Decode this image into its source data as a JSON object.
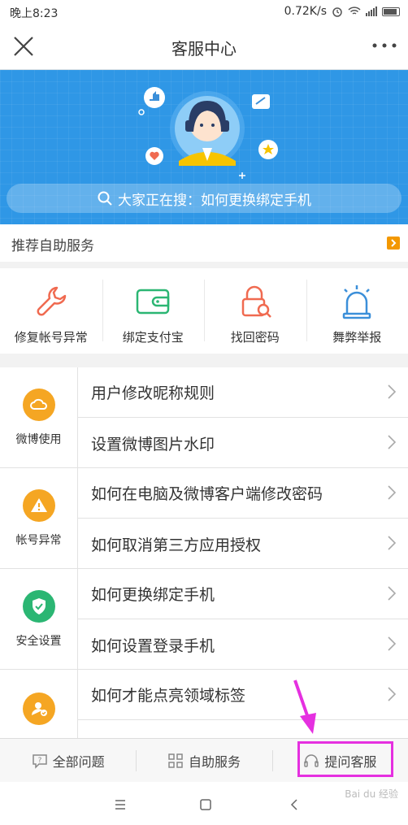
{
  "status_bar": {
    "time": "晚上8:23",
    "speed": "0.72K/s"
  },
  "header": {
    "title": "客服中心"
  },
  "banner": {
    "search_text": "大家正在搜：如何更换绑定手机"
  },
  "recommend": {
    "label": "推荐自助服务"
  },
  "quick_services": [
    {
      "label": "修复帐号异常",
      "icon": "wrench-icon",
      "color": "#f06a50"
    },
    {
      "label": "绑定支付宝",
      "icon": "wallet-icon",
      "color": "#2bb673"
    },
    {
      "label": "找回密码",
      "icon": "lock-search-icon",
      "color": "#f06a50"
    },
    {
      "label": "舞弊举报",
      "icon": "alarm-icon",
      "color": "#3b8fd9"
    }
  ],
  "faq_groups": [
    {
      "category": "微博使用",
      "icon": "cloud-icon",
      "color": "#f5a623",
      "questions": [
        "用户修改昵称规则",
        "设置微博图片水印"
      ]
    },
    {
      "category": "帐号异常",
      "icon": "warning-icon",
      "color": "#f5a623",
      "questions": [
        "如何在电脑及微博客户端修改密码",
        "如何取消第三方应用授权"
      ]
    },
    {
      "category": "安全设置",
      "icon": "shield-check-icon",
      "color": "#2bb673",
      "questions": [
        "如何更换绑定手机",
        "如何设置登录手机"
      ]
    },
    {
      "category": "",
      "icon": "user-check-icon",
      "color": "#f5a623",
      "questions": [
        "如何才能点亮领域标签",
        ""
      ]
    }
  ],
  "tabs": [
    {
      "label": "全部问题",
      "icon": "question-bubble-icon"
    },
    {
      "label": "自助服务",
      "icon": "grid-icon"
    },
    {
      "label": "提问客服",
      "icon": "headset-icon"
    }
  ],
  "watermark": "Bai du 经验"
}
